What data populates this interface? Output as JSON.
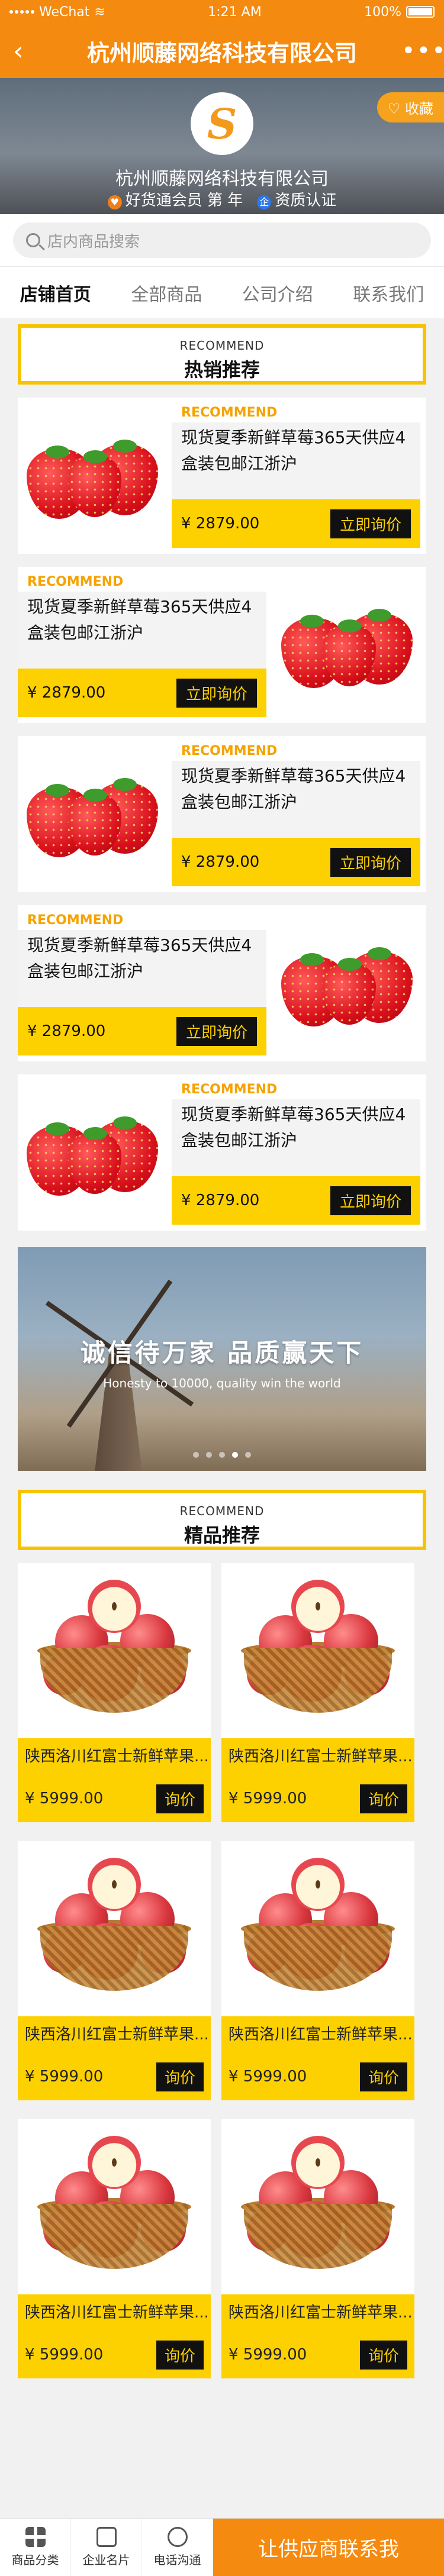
{
  "status_bar": {
    "carrier": "WeChat",
    "time": "1:21 AM",
    "battery": "100%"
  },
  "nav": {
    "back_icon": "‹",
    "title": "杭州顺藤网络科技有限公司",
    "more_icon": "•••"
  },
  "shop": {
    "logo_letter": "S",
    "name": "杭州顺藤网络科技有限公司",
    "collect_label": "♡ 收藏",
    "member_label": "好货通会员 第  年",
    "cert_label": "资质认证",
    "member_icon": "♥",
    "cert_icon": "企"
  },
  "search": {
    "placeholder": "店内商品搜索"
  },
  "tabs": [
    {
      "label": "店铺首页",
      "active": true
    },
    {
      "label": "全部商品",
      "active": false
    },
    {
      "label": "公司介绍",
      "active": false
    },
    {
      "label": "联系我们",
      "active": false
    }
  ],
  "section_hot": {
    "en": "RECOMMEND",
    "cn": "热销推荐"
  },
  "hot_products": [
    {
      "tag": "RECOMMEND",
      "title": "现货夏季新鲜草莓365天供应4盒装包邮江浙沪",
      "price": "¥ 2879.00",
      "button": "立即询价",
      "image_side": "left"
    },
    {
      "tag": "RECOMMEND",
      "title": "现货夏季新鲜草莓365天供应4盒装包邮江浙沪",
      "price": "¥ 2879.00",
      "button": "立即询价",
      "image_side": "right"
    },
    {
      "tag": "RECOMMEND",
      "title": "现货夏季新鲜草莓365天供应4盒装包邮江浙沪",
      "price": "¥ 2879.00",
      "button": "立即询价",
      "image_side": "left"
    },
    {
      "tag": "RECOMMEND",
      "title": "现货夏季新鲜草莓365天供应4盒装包邮江浙沪",
      "price": "¥ 2879.00",
      "button": "立即询价",
      "image_side": "right"
    },
    {
      "tag": "RECOMMEND",
      "title": "现货夏季新鲜草莓365天供应4盒装包邮江浙沪",
      "price": "¥ 2879.00",
      "button": "立即询价",
      "image_side": "left"
    }
  ],
  "banner": {
    "slogan": "诚信待万家  品质赢天下",
    "subtitle": "Honesty to 10000, quality win the world",
    "dots": 5,
    "active_dot": 4
  },
  "section_quality": {
    "en": "RECOMMEND",
    "cn": "精品推荐"
  },
  "quality_products": [
    {
      "title": "陕西洛川红富士新鲜苹果...",
      "price": "¥ 5999.00",
      "button": "询价"
    },
    {
      "title": "陕西洛川红富士新鲜苹果...",
      "price": "¥ 5999.00",
      "button": "询价"
    },
    {
      "title": "陕西洛川红富士新鲜苹果...",
      "price": "¥ 5999.00",
      "button": "询价"
    },
    {
      "title": "陕西洛川红富士新鲜苹果...",
      "price": "¥ 5999.00",
      "button": "询价"
    },
    {
      "title": "陕西洛川红富士新鲜苹果...",
      "price": "¥ 5999.00",
      "button": "询价"
    },
    {
      "title": "陕西洛川红富士新鲜苹果...",
      "price": "¥ 5999.00",
      "button": "询价"
    }
  ],
  "bottom_bar": {
    "items": [
      {
        "label": "商品分类",
        "icon": "grid-icon"
      },
      {
        "label": "企业名片",
        "icon": "card-icon"
      },
      {
        "label": "电话沟通",
        "icon": "phone-icon"
      }
    ],
    "cta": "让供应商联系我"
  },
  "colors": {
    "brand_orange": "#f58a10",
    "accent_yellow": "#fdd000",
    "tag_orange": "#f5a300"
  }
}
